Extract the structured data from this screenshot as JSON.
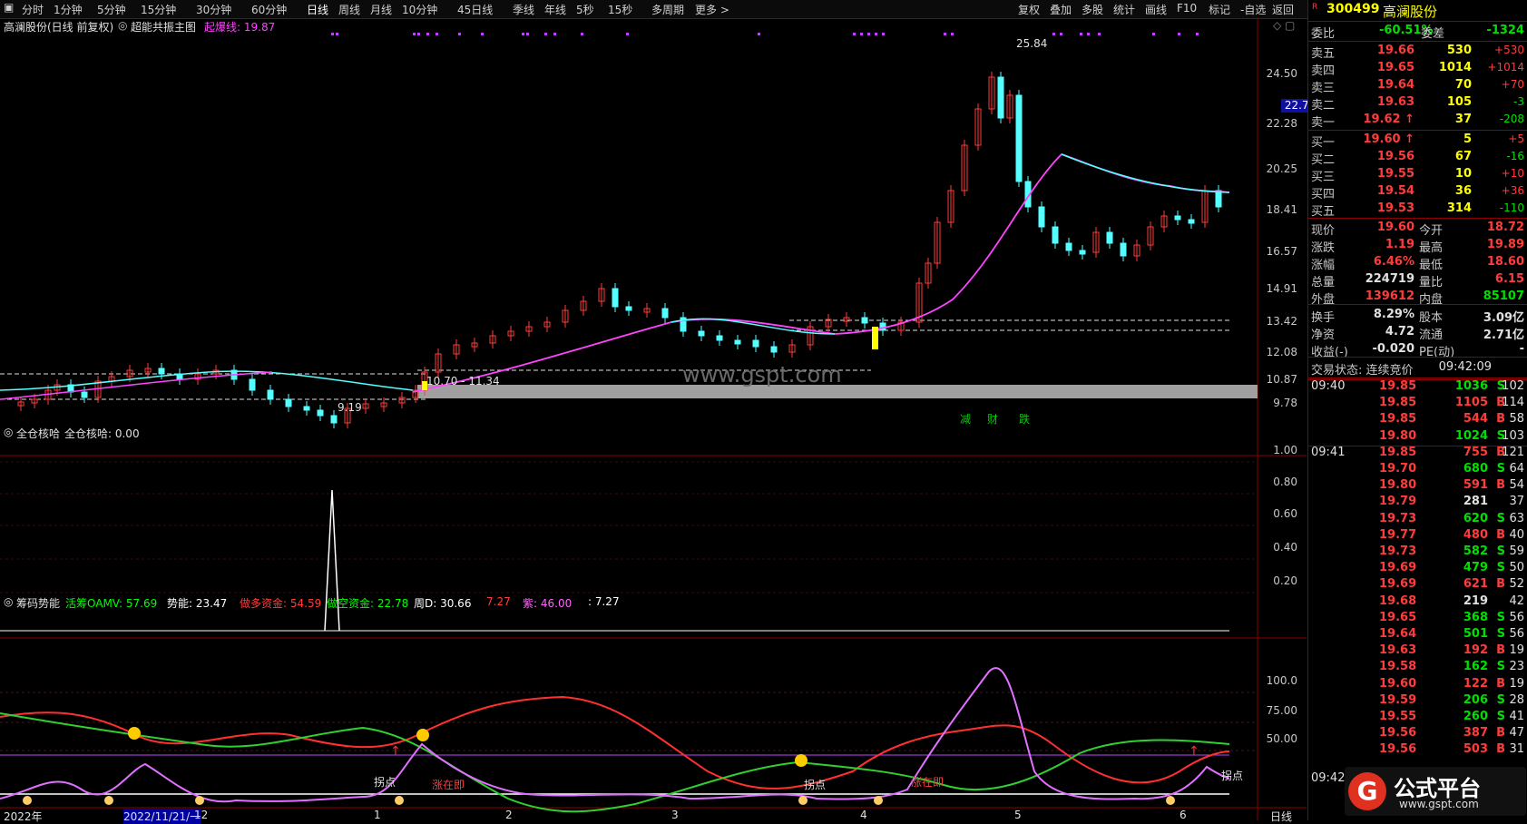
{
  "toolbar": {
    "periods": [
      "分时",
      "1分钟",
      "5分钟",
      "15分钟",
      "30分钟",
      "60分钟",
      "日线",
      "周线",
      "月线",
      "10分钟",
      "45日线",
      "季线",
      "年线",
      "5秒",
      "15秒",
      "多周期",
      "更多 >"
    ],
    "right_buttons": [
      "复权",
      "叠加",
      "多股",
      "统计",
      "画线",
      "F10",
      "标记",
      "-自选",
      "返回"
    ]
  },
  "chart_header": {
    "stock_title": "高澜股份(日线 前复权)",
    "indicator_name": "超能共振主图",
    "indicator_value": "起爆线: 19.87"
  },
  "main_axis": {
    "ticks": [
      "24.50",
      "22.28",
      "20.25",
      "18.41",
      "16.57",
      "14.91",
      "13.42",
      "12.08",
      "10.87",
      "9.78"
    ],
    "current_marker": "22.70"
  },
  "annotations": {
    "high": "25.84",
    "low": "9.19",
    "range": "10.70 - 11.34",
    "watermark": "www.gspt.com",
    "signals": [
      "减",
      "财",
      "跌"
    ]
  },
  "panel2": {
    "name": "全仓核哈",
    "label": "全仓核哈: 0.00",
    "ticks": [
      "1.00",
      "0.80",
      "0.60",
      "0.40",
      "0.20"
    ]
  },
  "panel3": {
    "name": "筹码势能",
    "items": [
      {
        "text": "活筹OAMV: 57.69",
        "color": "#00ff00"
      },
      {
        "text": "势能: 23.47",
        "color": "#ffffff"
      },
      {
        "text": "做多资金: 54.59",
        "color": "#ff3c3c"
      },
      {
        "text": "做空资金: 22.78",
        "color": "#00ff00"
      },
      {
        "text": "周D: 30.66",
        "color": "#ffffff"
      },
      {
        "text": "7.27",
        "color": "#ff3c3c"
      },
      {
        "text": "紫: 46.00",
        "color": "#ff66ff"
      },
      {
        "text": ": 7.27",
        "color": "#ffffff"
      }
    ],
    "ticks": [
      "100.0",
      "75.00",
      "50.00"
    ],
    "labels": {
      "guaidian": "拐点",
      "zhangzaiji": "涨在即"
    }
  },
  "date_axis": [
    "2022年",
    "2022/11/21/一",
    "12",
    "1",
    "2",
    "3",
    "4",
    "5",
    "6"
  ],
  "date_axis_right": "日线",
  "quote": {
    "code": "300499",
    "name": "高澜股份",
    "webi_label": "委比",
    "webi_value": "-60.51%",
    "weicha_label": "委差",
    "weicha_value": "-1324",
    "asks": [
      {
        "label": "卖五",
        "price": "19.66",
        "vol": "530",
        "chg": "+530"
      },
      {
        "label": "卖四",
        "price": "19.65",
        "vol": "1014",
        "chg": "+1014"
      },
      {
        "label": "卖三",
        "price": "19.64",
        "vol": "70",
        "chg": "+70"
      },
      {
        "label": "卖二",
        "price": "19.63",
        "vol": "105",
        "chg": "-3"
      },
      {
        "label": "卖一",
        "price": "19.62 ↑",
        "vol": "37",
        "chg": "-208"
      }
    ],
    "bids": [
      {
        "label": "买一",
        "price": "19.60 ↑",
        "vol": "5",
        "chg": "+5"
      },
      {
        "label": "买二",
        "price": "19.56",
        "vol": "67",
        "chg": "-16"
      },
      {
        "label": "买三",
        "price": "19.55",
        "vol": "10",
        "chg": "+10"
      },
      {
        "label": "买四",
        "price": "19.54",
        "vol": "36",
        "chg": "+36"
      },
      {
        "label": "买五",
        "price": "19.53",
        "vol": "314",
        "chg": "-110"
      }
    ],
    "stats": [
      {
        "l1": "现价",
        "v1": "19.60",
        "c1": "red",
        "l2": "今开",
        "v2": "18.72",
        "c2": "red"
      },
      {
        "l1": "涨跌",
        "v1": "1.19",
        "c1": "red",
        "l2": "最高",
        "v2": "19.89",
        "c2": "red"
      },
      {
        "l1": "涨幅",
        "v1": "6.46%",
        "c1": "red",
        "l2": "最低",
        "v2": "18.60",
        "c2": "red"
      },
      {
        "l1": "总量",
        "v1": "224719",
        "c1": "wht",
        "l2": "量比",
        "v2": "6.15",
        "c2": "red"
      },
      {
        "l1": "外盘",
        "v1": "139612",
        "c1": "red",
        "l2": "内盘",
        "v2": "85107",
        "c2": "grn"
      }
    ],
    "stats2": [
      {
        "l1": "换手",
        "v1": "8.29%",
        "c1": "wht",
        "l2": "股本",
        "v2": "3.09亿",
        "c2": "wht"
      },
      {
        "l1": "净资",
        "v1": "4.72",
        "c1": "wht",
        "l2": "流通",
        "v2": "2.71亿",
        "c2": "wht"
      },
      {
        "l1": "收益(-)",
        "v1": "-0.020",
        "c1": "wht",
        "l2": "PE(动)",
        "v2": "-",
        "c2": "wht"
      }
    ],
    "trade_status": "交易状态: 连续竞价",
    "trade_time": "09:42:09"
  },
  "ticks": [
    {
      "t": "09:40",
      "p": "19.85",
      "v": "1036",
      "bs": "S",
      "n": "102"
    },
    {
      "t": "",
      "p": "19.85",
      "v": "1105",
      "bs": "B",
      "n": "114"
    },
    {
      "t": "",
      "p": "19.85",
      "v": "544",
      "bs": "B",
      "n": "58"
    },
    {
      "t": "",
      "p": "19.80",
      "v": "1024",
      "bs": "S",
      "n": "103"
    },
    {
      "t": "09:41",
      "p": "19.85",
      "v": "755",
      "bs": "B",
      "n": "121"
    },
    {
      "t": "",
      "p": "19.70",
      "v": "680",
      "bs": "S",
      "n": "64"
    },
    {
      "t": "",
      "p": "19.80",
      "v": "591",
      "bs": "B",
      "n": "54"
    },
    {
      "t": "",
      "p": "19.79",
      "v": "281",
      "bs": "",
      "n": "37"
    },
    {
      "t": "",
      "p": "19.73",
      "v": "620",
      "bs": "S",
      "n": "63"
    },
    {
      "t": "",
      "p": "19.77",
      "v": "480",
      "bs": "B",
      "n": "40"
    },
    {
      "t": "",
      "p": "19.73",
      "v": "582",
      "bs": "S",
      "n": "59"
    },
    {
      "t": "",
      "p": "19.69",
      "v": "479",
      "bs": "S",
      "n": "50"
    },
    {
      "t": "",
      "p": "19.69",
      "v": "621",
      "bs": "B",
      "n": "52"
    },
    {
      "t": "",
      "p": "19.68",
      "v": "219",
      "bs": "",
      "n": "42"
    },
    {
      "t": "",
      "p": "19.65",
      "v": "368",
      "bs": "S",
      "n": "56"
    },
    {
      "t": "",
      "p": "19.64",
      "v": "501",
      "bs": "S",
      "n": "56"
    },
    {
      "t": "",
      "p": "19.63",
      "v": "192",
      "bs": "B",
      "n": "19"
    },
    {
      "t": "",
      "p": "19.58",
      "v": "162",
      "bs": "S",
      "n": "23"
    },
    {
      "t": "",
      "p": "19.60",
      "v": "122",
      "bs": "B",
      "n": "19"
    },
    {
      "t": "",
      "p": "19.59",
      "v": "206",
      "bs": "S",
      "n": "28"
    },
    {
      "t": "",
      "p": "19.55",
      "v": "260",
      "bs": "S",
      "n": "41"
    },
    {
      "t": "",
      "p": "19.56",
      "v": "387",
      "bs": "B",
      "n": "47"
    },
    {
      "t": "",
      "p": "19.56",
      "v": "503",
      "bs": "B",
      "n": "31"
    }
  ],
  "last_tick_time": "09:42",
  "logo": {
    "text": "公式平台",
    "url": "www.gspt.com"
  }
}
